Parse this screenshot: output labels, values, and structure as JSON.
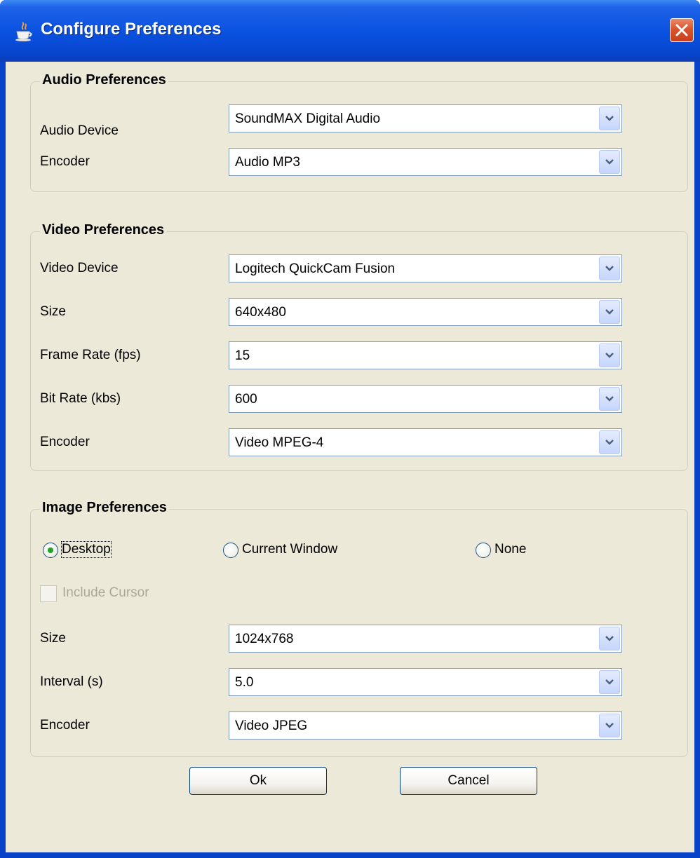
{
  "window": {
    "title": "Configure Preferences"
  },
  "audio": {
    "title": "Audio Preferences",
    "device_label": "Audio Device",
    "device_value": "SoundMAX Digital Audio",
    "encoder_label": "Encoder",
    "encoder_value": "Audio MP3"
  },
  "video": {
    "title": "Video Preferences",
    "device_label": "Video Device",
    "device_value": "Logitech QuickCam Fusion",
    "size_label": "Size",
    "size_value": "640x480",
    "framerate_label": "Frame Rate (fps)",
    "framerate_value": "15",
    "bitrate_label": "Bit Rate (kbs)",
    "bitrate_value": "600",
    "encoder_label": "Encoder",
    "encoder_value": "Video MPEG-4"
  },
  "image": {
    "title": "Image Preferences",
    "radio_desktop": "Desktop",
    "radio_current_window": "Current Window",
    "radio_none": "None",
    "selected_radio": "Desktop",
    "include_cursor_label": "Include Cursor",
    "include_cursor_checked": false,
    "include_cursor_enabled": false,
    "size_label": "Size",
    "size_value": "1024x768",
    "interval_label": "Interval (s)",
    "interval_value": "5.0",
    "encoder_label": "Encoder",
    "encoder_value": "Video JPEG"
  },
  "buttons": {
    "ok": "Ok",
    "cancel": "Cancel"
  },
  "colors": {
    "titlebar": "#0a52e0",
    "client_bg": "#ece9d8",
    "close_button": "#d9542b",
    "radio_selected": "#21a121"
  }
}
